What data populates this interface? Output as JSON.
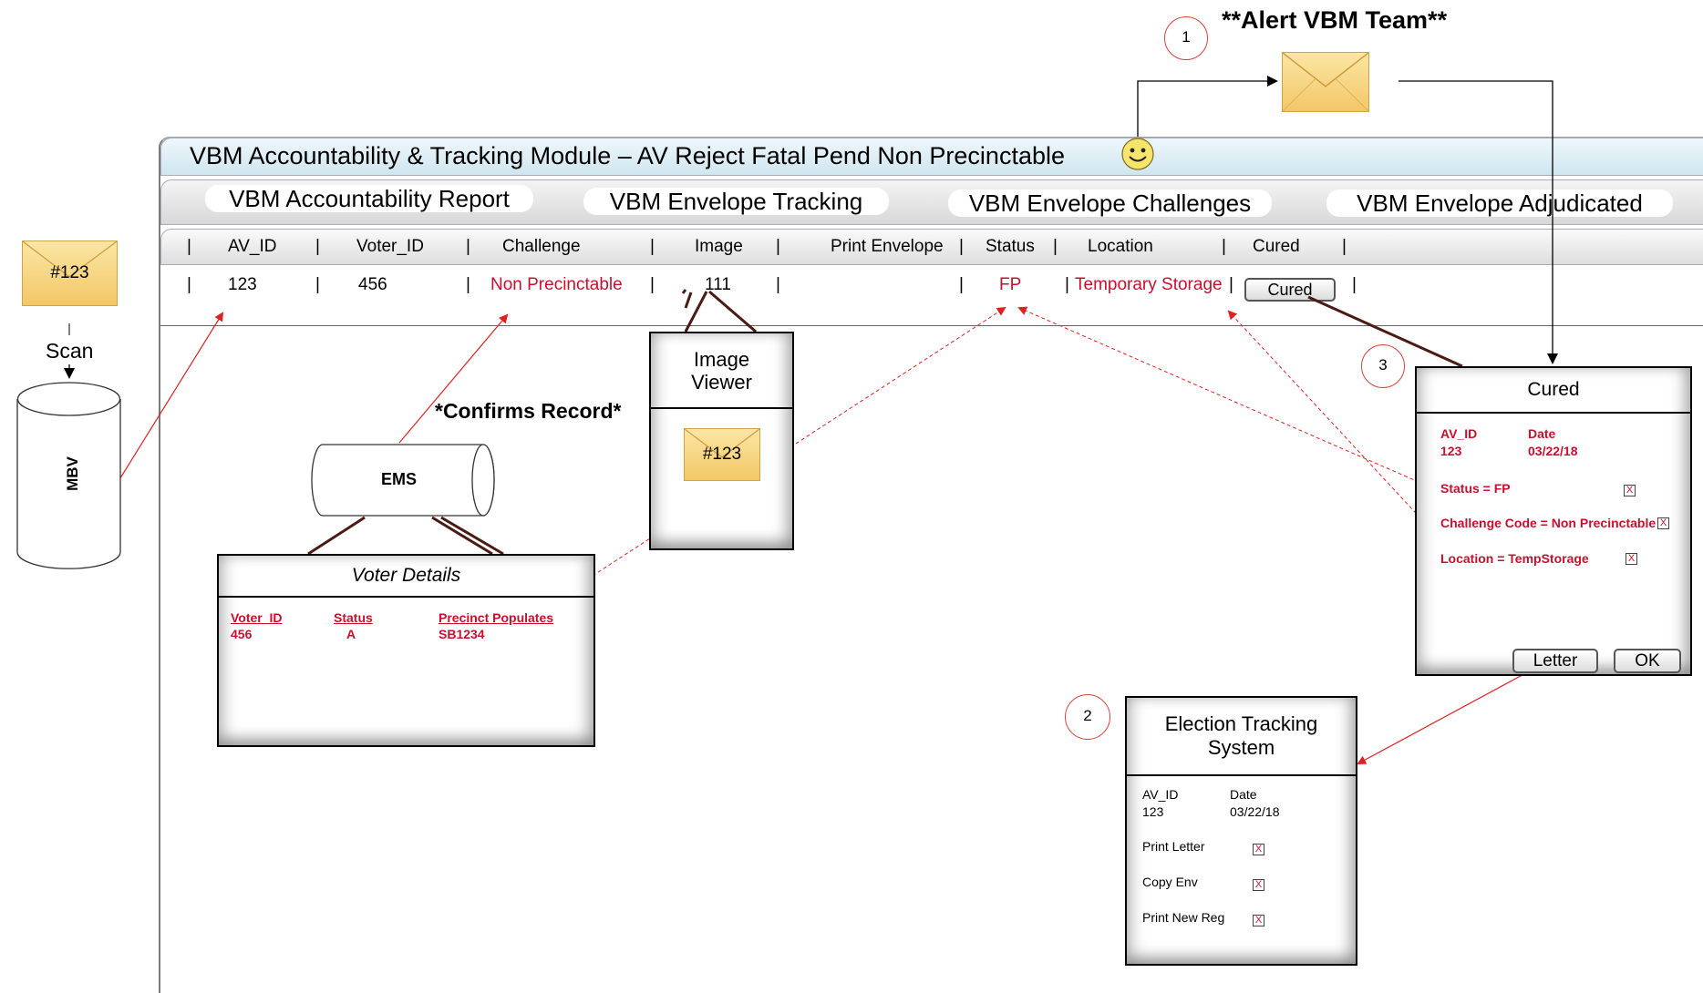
{
  "alert": {
    "number": "1",
    "title": "**Alert VBM Team**"
  },
  "module": {
    "title": "VBM Accountability & Tracking Module – AV Reject Fatal Pend Non Precinctable"
  },
  "tabs": [
    {
      "label": "VBM Accountability Report"
    },
    {
      "label": "VBM Envelope Tracking"
    },
    {
      "label": "VBM Envelope Challenges"
    },
    {
      "label": "VBM Envelope Adjudicated"
    }
  ],
  "table": {
    "separator": "|",
    "columns": [
      "AV_ID",
      "Voter_ID",
      "Challenge",
      "Image",
      "Print Envelope",
      "Status",
      "Location",
      "Cured"
    ],
    "row": {
      "av_id": "123",
      "voter_id": "456",
      "challenge": "Non Precinctable",
      "image": "111",
      "status": "FP",
      "location": "Temporary Storage",
      "cured_button": "Cured"
    }
  },
  "scan": {
    "envelope_label": "#123",
    "label": "Scan",
    "db_label": "MBV"
  },
  "ems": {
    "label": "EMS",
    "annotation": "*Confirms Record*"
  },
  "voter_details": {
    "title": "Voter Details",
    "headers": [
      "Voter_ID",
      "Status",
      "Precinct Populates"
    ],
    "values": [
      "456",
      "A",
      "SB1234"
    ]
  },
  "image_viewer": {
    "title_line1": "Image",
    "title_line2": "Viewer",
    "envelope_label": "#123"
  },
  "cured_dialog": {
    "number": "3",
    "title": "Cured",
    "av_id_label": "AV_ID",
    "av_id_value": "123",
    "date_label": "Date",
    "date_value": "03/22/18",
    "items": [
      "Status = FP",
      "Challenge Code = Non Precinctable",
      "Location = TempStorage"
    ],
    "check_mark": "X",
    "letter_button": "Letter",
    "ok_button": "OK"
  },
  "election_tracking": {
    "number": "2",
    "title_line1": "Election Tracking",
    "title_line2": "System",
    "av_id_label": "AV_ID",
    "av_id_value": "123",
    "date_label": "Date",
    "date_value": "03/22/18",
    "items": [
      "Print Letter",
      "Copy Env",
      "Print New Reg"
    ],
    "check_mark": "X"
  },
  "colors": {
    "accent_red": "#c8102e",
    "envelope": "#f3c767",
    "header_blue": "#dbeef7"
  }
}
